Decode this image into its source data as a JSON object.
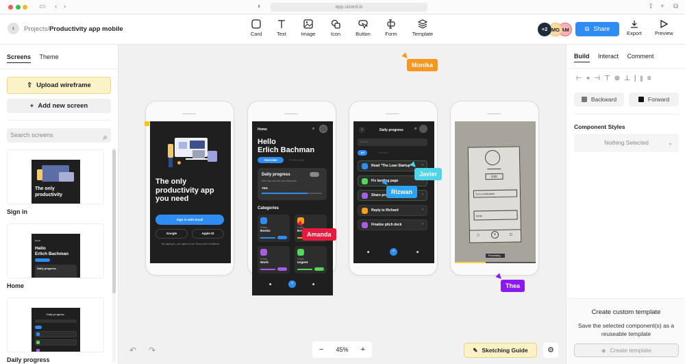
{
  "browser": {
    "url": "app.uizard.io"
  },
  "header": {
    "breadcrumb_parent": "Projects",
    "breadcrumb_separator": "/",
    "breadcrumb_current": "Productivity app mobile",
    "tools": [
      {
        "label": "Card",
        "icon": "card-icon"
      },
      {
        "label": "Text",
        "icon": "text-icon"
      },
      {
        "label": "Image",
        "icon": "image-icon"
      },
      {
        "label": "Icon",
        "icon": "shapes-icon"
      },
      {
        "label": "Button",
        "icon": "button-icon"
      },
      {
        "label": "Form",
        "icon": "form-icon"
      },
      {
        "label": "Template",
        "icon": "layers-icon"
      }
    ],
    "collaborators": [
      {
        "initials": "+2",
        "color": "#1e2b3a"
      },
      {
        "initials": "MG",
        "color": "#fbd9a0"
      },
      {
        "initials": "AM",
        "color": "#f7b3b8"
      }
    ],
    "share_label": "Share",
    "export_label": "Export",
    "preview_label": "Preview"
  },
  "left_panel": {
    "tabs": [
      "Screens",
      "Theme"
    ],
    "active_tab": "Screens",
    "upload_label": "Upload wireframe",
    "add_screen_label": "Add new screen",
    "search_placeholder": "Search screens",
    "screens": [
      {
        "name": "Sign in"
      },
      {
        "name": "Home"
      },
      {
        "name": "Daily progress"
      }
    ]
  },
  "canvas": {
    "signin": {
      "headline": "The only productivity app you need",
      "email_btn": "Sign in with Email",
      "google_btn": "Google",
      "apple_btn": "Apple ID",
      "terms": "By signing in, you agree to our Terms and Conditions"
    },
    "home": {
      "nav_title": "Home",
      "greeting": "Hello",
      "name": "Erlich Bachman",
      "tab_overview": "Overview",
      "tab_productivity": "Productivity",
      "progress_title": "Daily progress",
      "progress_sub": "Here you can see your daily task",
      "progress_value": "76%",
      "progress_fraction": 0.76,
      "categories_title": "Categories",
      "categories": [
        {
          "count": "5 New",
          "name": "Books",
          "color": "#2f8cf3"
        },
        {
          "count": "3 New",
          "name": "Errands",
          "color": "#f59e1b"
        },
        {
          "count": "6 New",
          "name": "Work",
          "color": "#a85ee0"
        },
        {
          "count": "3 New",
          "name": "Urgent",
          "color": "#54d65a"
        }
      ]
    },
    "daily": {
      "nav_title": "Daily progress",
      "search_placeholder": "Search",
      "tab_all": "All",
      "tab_fav": "Favorite",
      "tasks": [
        {
          "label": "Read \"The Lean Startup\"",
          "color": "#2f8cf3"
        },
        {
          "label": "Fix landing page",
          "color": "#54d65a"
        },
        {
          "label": "Share progress",
          "color": "#a85ee0"
        },
        {
          "label": "Reply to Richard",
          "color": "#f59e1b"
        },
        {
          "label": "Finalize pitch deck",
          "color": "#a85ee0"
        }
      ]
    },
    "wireframe": {
      "status": "Processing..."
    },
    "cursors": [
      {
        "name": "Monika",
        "color": "#f7971e"
      },
      {
        "name": "Amanda",
        "color": "#e8193c"
      },
      {
        "name": "Javier",
        "color": "#4fd4ea"
      },
      {
        "name": "Rizwan",
        "color": "#2ea3f2"
      },
      {
        "name": "Thea",
        "color": "#8a19f2"
      }
    ],
    "zoom_level": "45%",
    "sketching_guide_label": "Sketching Guide"
  },
  "right_panel": {
    "tabs": [
      "Build",
      "Interact",
      "Comment"
    ],
    "active_tab": "Build",
    "backward_label": "Backward",
    "forward_label": "Forward",
    "component_styles_title": "Component Styles",
    "component_styles_value": "Nothing Selected",
    "custom_template_title": "Create custom template",
    "custom_template_desc": "Save the selected component(s) as a reuseable template",
    "create_template_label": "Create template"
  }
}
